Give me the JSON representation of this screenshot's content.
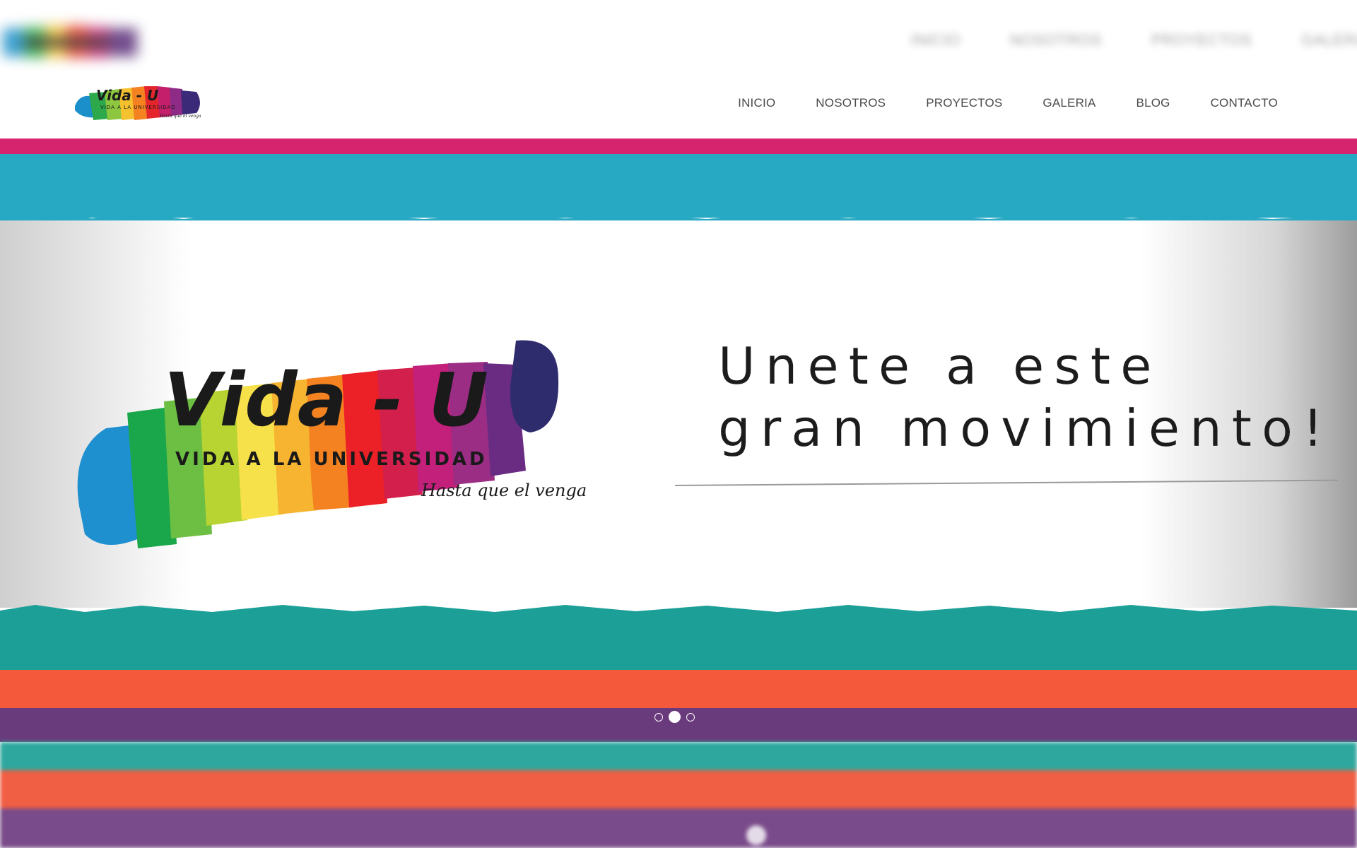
{
  "ghost_nav": [
    "INICIO",
    "NOSOTROS",
    "PROYECTOS",
    "GALERIA"
  ],
  "logo": {
    "title": "Vida - U",
    "subtitle": "VIDA A LA UNIVERSIDAD",
    "tagline": "Hasta que el venga"
  },
  "nav": {
    "items": [
      {
        "label": "INICIO"
      },
      {
        "label": "NOSOTROS"
      },
      {
        "label": "PROYECTOS"
      },
      {
        "label": "GALERIA"
      },
      {
        "label": "BLOG"
      },
      {
        "label": "CONTACTO"
      }
    ]
  },
  "hero": {
    "headline_line1": "Unete a este",
    "headline_line2": "gran movimiento!",
    "slides_total": 3,
    "active_slide": 2
  },
  "colors": {
    "magenta": "#d6246e",
    "cyan": "#27a9c4",
    "teal": "#1b9f97",
    "coral": "#f4593c",
    "purple": "#6a3b7c",
    "nav_text": "#4a4a4a"
  }
}
